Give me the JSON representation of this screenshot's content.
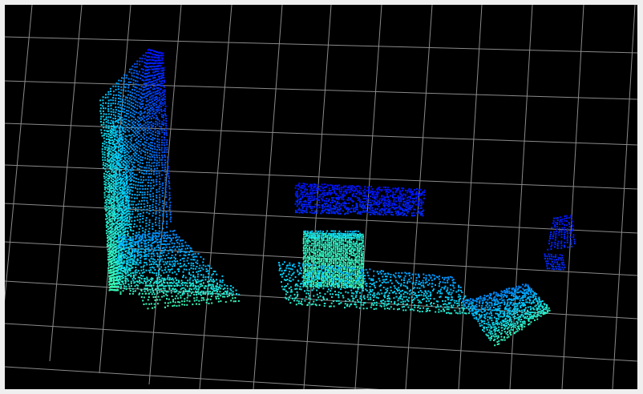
{
  "viewer": {
    "background": "#000000",
    "frame_color": "#efefef",
    "grid_visible": true,
    "grid_color": "#8a8a8a",
    "colormap": "jet",
    "colormap_stops": [
      "#0000ff",
      "#0080ff",
      "#00d0ff",
      "#40ffb0"
    ],
    "objects": [
      {
        "name": "wall-left-column",
        "label": ""
      },
      {
        "name": "floor-left-patch",
        "label": ""
      },
      {
        "name": "floating-blue-bar",
        "label": ""
      },
      {
        "name": "green-box",
        "label": ""
      },
      {
        "name": "floor-center-strip",
        "label": ""
      },
      {
        "name": "floor-right-patch",
        "label": ""
      },
      {
        "name": "right-blue-cluster",
        "label": ""
      }
    ]
  }
}
